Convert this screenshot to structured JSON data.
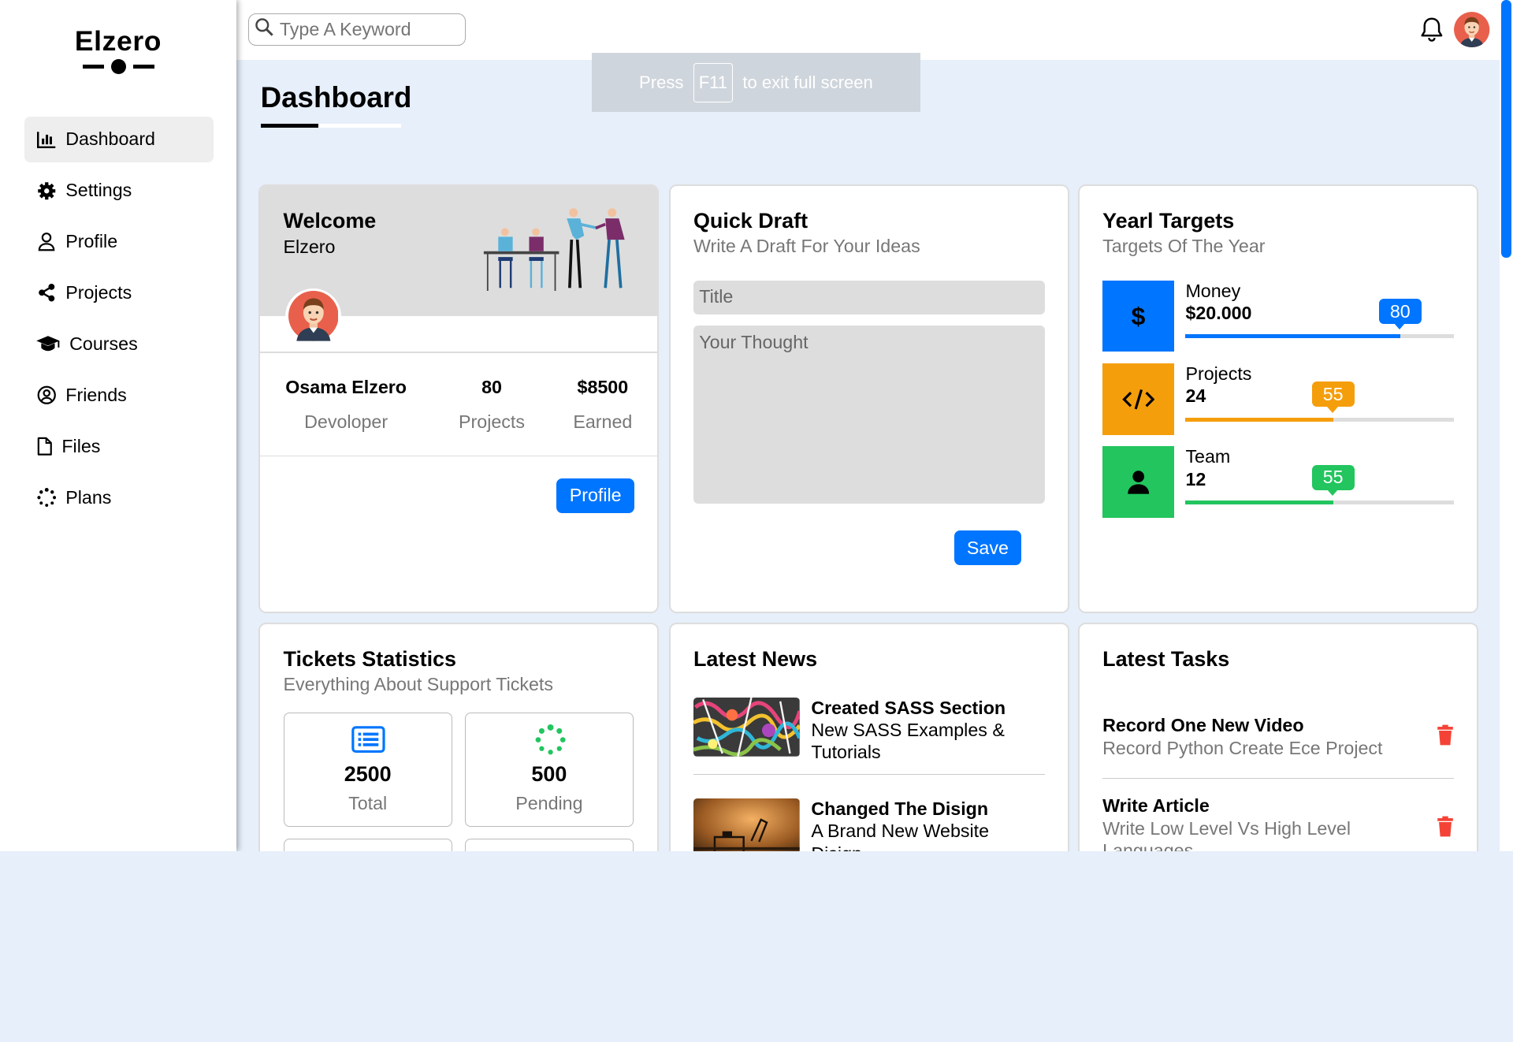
{
  "brand": {
    "name": "Elzero"
  },
  "sidebar": {
    "items": [
      {
        "label": "Dashboard",
        "icon": "chart-bar-icon"
      },
      {
        "label": "Settings",
        "icon": "gear-icon"
      },
      {
        "label": "Profile",
        "icon": "user-icon"
      },
      {
        "label": "Projects",
        "icon": "share-nodes-icon"
      },
      {
        "label": "Courses",
        "icon": "graduation-cap-icon"
      },
      {
        "label": "Friends",
        "icon": "user-circle-icon"
      },
      {
        "label": "Files",
        "icon": "file-icon"
      },
      {
        "label": "Plans",
        "icon": "spinner-icon"
      }
    ]
  },
  "topbar": {
    "search_placeholder": "Type A Keyword"
  },
  "fullscreen_notice": {
    "press": "Press",
    "key": "F11",
    "rest": "to exit full screen"
  },
  "page": {
    "title": "Dashboard"
  },
  "welcome": {
    "title": "Welcome",
    "name": "Elzero",
    "full_name": "Osama Elzero",
    "role": "Devoloper",
    "projects_value": "80",
    "projects_label": "Projects",
    "earned_value": "$8500",
    "earned_label": "Earned",
    "button": "Profile"
  },
  "draft": {
    "title": "Quick Draft",
    "subtitle": "Write A Draft For Your Ideas",
    "title_placeholder": "Title",
    "thought_placeholder": "Your Thought",
    "button": "Save"
  },
  "targets": {
    "title": "Yearl Targets",
    "subtitle": "Targets Of The Year",
    "items": [
      {
        "name": "Money",
        "value": "$20.000",
        "percent": 80,
        "badge": "80",
        "color": "#0075ff",
        "icon": "dollar-icon"
      },
      {
        "name": "Projects",
        "value": "24",
        "percent": 55,
        "badge": "55",
        "color": "#f59e0b",
        "icon": "code-icon"
      },
      {
        "name": "Team",
        "value": "12",
        "percent": 55,
        "badge": "55",
        "color": "#22c55e",
        "icon": "user-icon"
      }
    ]
  },
  "tickets": {
    "title": "Tickets Statistics",
    "subtitle": "Everything About Support Tickets",
    "items": [
      {
        "value": "2500",
        "label": "Total",
        "icon": "list-icon"
      },
      {
        "value": "500",
        "label": "Pending",
        "icon": "spinner-icon"
      }
    ]
  },
  "news": {
    "title": "Latest News",
    "items": [
      {
        "title": "Created SASS Section",
        "desc": "New SASS Examples & Tutorials"
      },
      {
        "title": "Changed The Disign",
        "desc": "A Brand New Website Disign"
      }
    ]
  },
  "tasks": {
    "title": "Latest Tasks",
    "items": [
      {
        "title": "Record One New Video",
        "desc": "Record Python Create Ece Project"
      },
      {
        "title": "Write Article",
        "desc": "Write Low Level Vs High Level Languages"
      }
    ]
  }
}
